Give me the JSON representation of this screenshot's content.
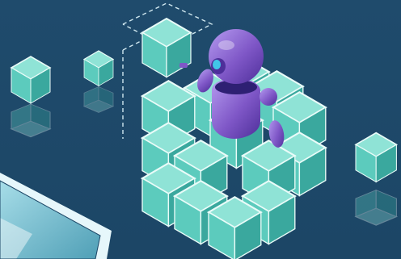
{
  "colors": {
    "background": "#1e4a6b",
    "cube_top": "#8fe3d6",
    "cube_left": "#5ccbbd",
    "cube_right": "#3aa89e",
    "cube_edge": "#e9fbf8",
    "reflection": "#2a6d7e",
    "robot_body": "#7f57c7",
    "robot_highlight": "#b59bf0",
    "robot_shadow": "#4e2f9a",
    "robot_visor": "#2e2073",
    "robot_accent": "#41c6e8",
    "dashed_guide": "#cfe7ef",
    "laptop_frame": "#e6f7fb",
    "laptop_screen": "#6fb7c9"
  },
  "icons": [
    "robot-icon",
    "cube-icon"
  ]
}
